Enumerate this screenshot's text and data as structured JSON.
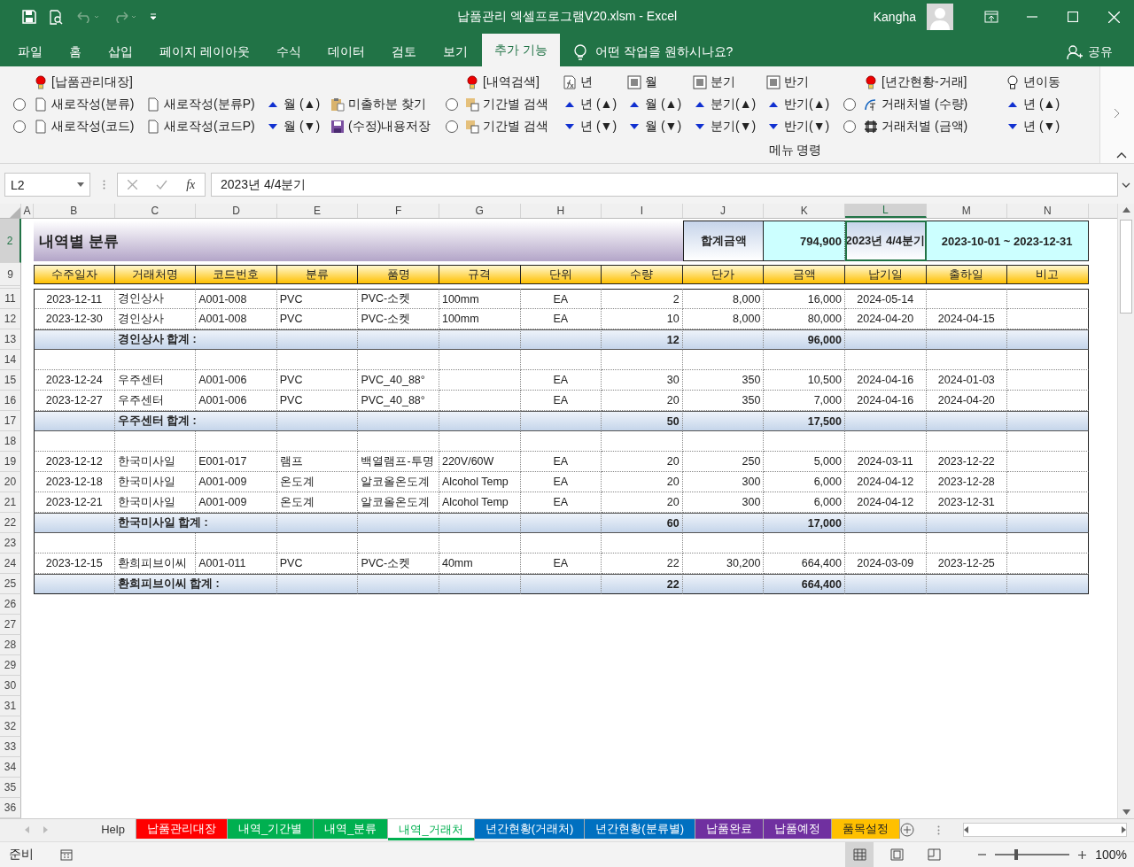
{
  "title_bar": {
    "title": "납품관리 엑셀프로그램V20.xlsm  -  Excel",
    "user": "Kangha"
  },
  "menu_tabs": [
    {
      "label": "파일",
      "selected": false
    },
    {
      "label": "홈",
      "selected": false
    },
    {
      "label": "삽입",
      "selected": false
    },
    {
      "label": "페이지 레이아웃",
      "selected": false
    },
    {
      "label": "수식",
      "selected": false
    },
    {
      "label": "데이터",
      "selected": false
    },
    {
      "label": "검토",
      "selected": false
    },
    {
      "label": "보기",
      "selected": false
    },
    {
      "label": "추가 기능",
      "selected": true
    }
  ],
  "tell_me": "어떤 작업을 원하시나요?",
  "share": "공유",
  "ribbon": {
    "group_label": "메뉴 명령",
    "columns": [
      {
        "items": [
          {
            "kind": "radio",
            "selected": false
          },
          {
            "kind": "radio",
            "selected": false
          }
        ]
      },
      {
        "items": [
          {
            "kind": "heading",
            "label": "[납품관리대장]"
          },
          {
            "kind": "page",
            "label": "새로작성(분류)"
          },
          {
            "kind": "page",
            "label": "새로작성(코드)"
          }
        ]
      },
      {
        "items": [
          {
            "kind": "page",
            "label": "새로작성(분류P)"
          },
          {
            "kind": "page",
            "label": "새로작성(코드P)"
          }
        ]
      },
      {
        "items": [
          {
            "kind": "up",
            "label": "월 (▲)"
          },
          {
            "kind": "down",
            "label": "월 (▼)"
          }
        ]
      },
      {
        "items": [
          {
            "kind": "clipboard",
            "label": "미출하분 찾기"
          },
          {
            "kind": "save",
            "label": "(수정)내용저장"
          }
        ]
      },
      {
        "items": [
          {
            "kind": "radio",
            "selected": false
          },
          {
            "kind": "radio",
            "selected": false
          }
        ]
      },
      {
        "items": [
          {
            "kind": "heading",
            "label": "[내역검색]"
          },
          {
            "kind": "copy",
            "label": "기간별 검색"
          },
          {
            "kind": "copy",
            "label": "기간별 검색"
          }
        ]
      },
      {
        "items": [
          {
            "kind": "function",
            "label": "년"
          },
          {
            "kind": "up",
            "label": "년 (▲)"
          },
          {
            "kind": "down",
            "label": "년 (▼)"
          }
        ]
      },
      {
        "items": [
          {
            "kind": "grid",
            "label": "월"
          },
          {
            "kind": "up",
            "label": "월 (▲)"
          },
          {
            "kind": "down",
            "label": "월 (▼)"
          }
        ]
      },
      {
        "items": [
          {
            "kind": "grid",
            "label": "분기"
          },
          {
            "kind": "up",
            "label": "분기(▲)"
          },
          {
            "kind": "down",
            "label": "분기(▼)"
          }
        ]
      },
      {
        "items": [
          {
            "kind": "grid",
            "label": "반기"
          },
          {
            "kind": "up",
            "label": "반기(▲)"
          },
          {
            "kind": "down",
            "label": "반기(▼)"
          }
        ]
      },
      {
        "items": [
          {
            "kind": "radio",
            "selected": false
          },
          {
            "kind": "radio",
            "selected": false
          }
        ]
      },
      {
        "items": [
          {
            "kind": "heading",
            "label": "[년간현황-거래]"
          },
          {
            "kind": "orientation",
            "label": "거래처별 (수량)"
          },
          {
            "kind": "table",
            "label": "거래처별 (금액)"
          }
        ]
      },
      {
        "items": [
          {
            "kind": "hint",
            "label": "년이동"
          },
          {
            "kind": "up",
            "label": "년 (▲)"
          },
          {
            "kind": "down",
            "label": "년 (▼)"
          }
        ]
      }
    ]
  },
  "formula_bar": {
    "name_box": "L2",
    "fx": "fx",
    "formula": "2023년 4/4분기"
  },
  "sheet": {
    "columns": [
      {
        "label": "A",
        "selected": false
      },
      {
        "label": "B",
        "selected": false
      },
      {
        "label": "C",
        "selected": false
      },
      {
        "label": "D",
        "selected": false
      },
      {
        "label": "E",
        "selected": false
      },
      {
        "label": "F",
        "selected": false
      },
      {
        "label": "G",
        "selected": false
      },
      {
        "label": "H",
        "selected": false
      },
      {
        "label": "I",
        "selected": false
      },
      {
        "label": "J",
        "selected": false
      },
      {
        "label": "K",
        "selected": false
      },
      {
        "label": "L",
        "selected": true
      },
      {
        "label": "M",
        "selected": false
      },
      {
        "label": "N",
        "selected": false
      }
    ],
    "summary": {
      "row": "2",
      "row_selected": true,
      "title": "내역별 분류",
      "total_label": "합계금액",
      "total": "794,900",
      "period": "2023년 4/4분기",
      "period_selected": true,
      "range": "2023-10-01 ~ 2023-12-31"
    },
    "header_row": "9",
    "table_columns": [
      "수주일자",
      "거래처명",
      "코드번호",
      "분류",
      "품명",
      "규격",
      "단위",
      "수량",
      "단가",
      "금액",
      "납기일",
      "출하일",
      "비고"
    ],
    "rows": [
      {
        "row": "11",
        "kind": "item",
        "order_date": "2023-12-11",
        "client": "경인상사",
        "code": "A001-008",
        "category": "PVC",
        "product": "PVC-소켓",
        "spec": "100mm",
        "unit": "EA",
        "qty": "2",
        "price": "8,000",
        "amount": "16,000",
        "due_date": "2024-05-14"
      },
      {
        "row": "12",
        "kind": "item",
        "order_date": "2023-12-30",
        "client": "경인상사",
        "code": "A001-008",
        "category": "PVC",
        "product": "PVC-소켓",
        "spec": "100mm",
        "unit": "EA",
        "qty": "10",
        "price": "8,000",
        "amount": "80,000",
        "due_date": "2024-04-20",
        "ship_date": "2024-04-15"
      },
      {
        "row": "13",
        "kind": "subtotal",
        "client": "경인상사 합계  :",
        "qty": "12",
        "amount": "96,000"
      },
      {
        "row": "14",
        "kind": "blank"
      },
      {
        "row": "15",
        "kind": "item",
        "order_date": "2023-12-24",
        "client": "우주센터",
        "code": "A001-006",
        "category": "PVC",
        "product": "PVC_40_88°",
        "unit": "EA",
        "qty": "30",
        "price": "350",
        "amount": "10,500",
        "due_date": "2024-04-16",
        "ship_date": "2024-01-03"
      },
      {
        "row": "16",
        "kind": "item",
        "order_date": "2023-12-27",
        "client": "우주센터",
        "code": "A001-006",
        "category": "PVC",
        "product": "PVC_40_88°",
        "unit": "EA",
        "qty": "20",
        "price": "350",
        "amount": "7,000",
        "due_date": "2024-04-16",
        "ship_date": "2024-04-20"
      },
      {
        "row": "17",
        "kind": "subtotal",
        "client": "우주센터 합계  :",
        "qty": "50",
        "amount": "17,500"
      },
      {
        "row": "18",
        "kind": "blank"
      },
      {
        "row": "19",
        "kind": "item",
        "order_date": "2023-12-12",
        "client": "한국미사일",
        "code": "E001-017",
        "category": "램프",
        "product": "백열램프-투명",
        "spec": "220V/60W",
        "unit": "EA",
        "qty": "20",
        "price": "250",
        "amount": "5,000",
        "due_date": "2024-03-11",
        "ship_date": "2023-12-22"
      },
      {
        "row": "20",
        "kind": "item",
        "order_date": "2023-12-18",
        "client": "한국미사일",
        "code": "A001-009",
        "category": "온도계",
        "product": "알코올온도계",
        "spec": "Alcohol Temp",
        "unit": "EA",
        "qty": "20",
        "price": "300",
        "amount": "6,000",
        "due_date": "2024-04-12",
        "ship_date": "2023-12-28"
      },
      {
        "row": "21",
        "kind": "item",
        "order_date": "2023-12-21",
        "client": "한국미사일",
        "code": "A001-009",
        "category": "온도계",
        "product": "알코올온도계",
        "spec": "Alcohol Temp",
        "unit": "EA",
        "qty": "20",
        "price": "300",
        "amount": "6,000",
        "due_date": "2024-04-12",
        "ship_date": "2023-12-31"
      },
      {
        "row": "22",
        "kind": "subtotal",
        "client": "한국미사일 합계  :",
        "qty": "60",
        "amount": "17,000"
      },
      {
        "row": "23",
        "kind": "blank"
      },
      {
        "row": "24",
        "kind": "item",
        "order_date": "2023-12-15",
        "client": "환희피브이씨",
        "code": "A001-011",
        "category": "PVC",
        "product": "PVC-소켓",
        "spec": "40mm",
        "unit": "EA",
        "qty": "22",
        "price": "30,200",
        "amount": "664,400",
        "due_date": "2024-03-09",
        "ship_date": "2023-12-25"
      },
      {
        "row": "25",
        "kind": "subtotal",
        "client": "환희피브이씨 합계  :",
        "qty": "22",
        "amount": "664,400"
      }
    ],
    "empty_rows": [
      "26",
      "27",
      "28",
      "29",
      "30",
      "31",
      "32",
      "33",
      "34",
      "35",
      "36"
    ]
  },
  "sheet_tabs": [
    {
      "label": "Help",
      "selected": false
    },
    {
      "label": "납품관리대장",
      "selected": false,
      "color": "#ff0000"
    },
    {
      "label": "내역_기간별",
      "selected": false,
      "color": "#00b050"
    },
    {
      "label": "내역_분류",
      "selected": false,
      "color": "#00b050"
    },
    {
      "label": "내역_거래처",
      "selected": true,
      "color": "#00b050"
    },
    {
      "label": "년간현황(거래처)",
      "selected": false,
      "color": "#0070c0"
    },
    {
      "label": "년간현황(분류별)",
      "selected": false,
      "color": "#0070c0"
    },
    {
      "label": "납품완료",
      "selected": false,
      "color": "#7030a0"
    },
    {
      "label": "납품예정",
      "selected": false,
      "color": "#7030a0"
    },
    {
      "label": "품목설정",
      "selected": false,
      "color": "#ffc000"
    }
  ],
  "status_bar": {
    "status": "준비",
    "zoom": "100%",
    "zoom_slider": {
      "level": 0.28
    }
  }
}
